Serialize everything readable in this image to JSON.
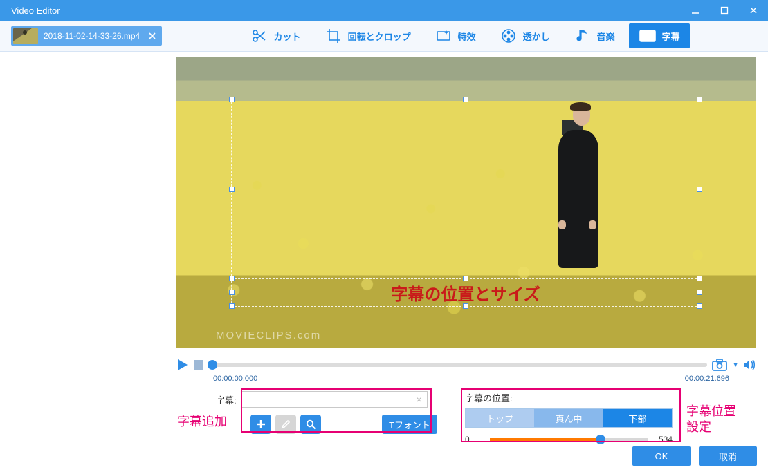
{
  "window": {
    "title": "Video Editor"
  },
  "file": {
    "name": "2018-11-02-14-33-26.mp4"
  },
  "tools": {
    "cut": "カット",
    "rotate_crop": "回転とクロップ",
    "effect": "特效",
    "watermark": "透かし",
    "music": "音楽",
    "subtitle": "字幕",
    "active": "subtitle"
  },
  "preview": {
    "watermark_text": "MOVIECLIPS.com",
    "subtitle_overlay": "字幕の位置とサイズ"
  },
  "timeline": {
    "current": "00:00:00.000",
    "total": "00:00:21.696"
  },
  "form": {
    "subtitle_label": "字幕:",
    "subtitle_value": "",
    "font_button": "Tフォント",
    "position_label": "字幕の位置:",
    "position_top": "トップ",
    "position_middle": "真ん中",
    "position_bottom": "下部",
    "position_selected": "下部",
    "slider_min": "0",
    "slider_max": "534"
  },
  "annotations": {
    "add_subtitle": "字幕追加",
    "position_setting_line1": "字幕位置",
    "position_setting_line2": "設定"
  },
  "footer": {
    "ok": "OK",
    "cancel": "取消"
  }
}
